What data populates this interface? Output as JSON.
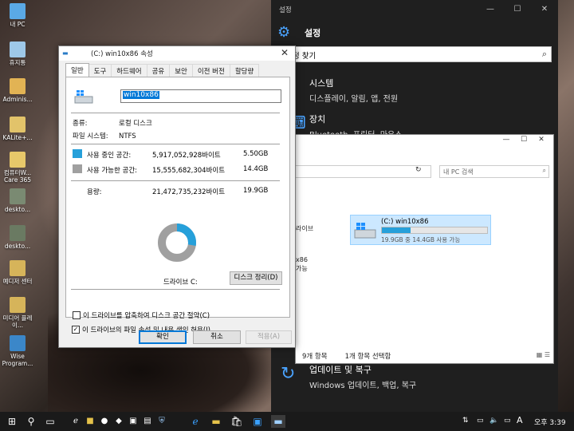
{
  "desktop": {
    "icons": [
      {
        "label": "내 PC",
        "color": "#5aa9e6"
      },
      {
        "label": "휴지통",
        "color": "#9ec8e8"
      },
      {
        "label": "Adminis...",
        "color": "#e2b354"
      },
      {
        "label": "KALite+...",
        "color": "#e2c36a"
      },
      {
        "label": "컴퓨터W... Care 365",
        "color": "#e7c86a"
      },
      {
        "label": "deskto...",
        "color": "#7a8a72"
      },
      {
        "label": "deskto...",
        "color": "#6a7a62"
      },
      {
        "label": "예디저 센터",
        "color": "#d6b45a"
      },
      {
        "label": "미디어 플레이...",
        "color": "#d6b45a"
      },
      {
        "label": "Wise Program...",
        "color": "#3b87c9"
      }
    ]
  },
  "settings": {
    "window_title": "설정",
    "minimize": "—",
    "maximize": "☐",
    "close": "✕",
    "heading": "설정",
    "search_text": "정 찾기",
    "categories": [
      {
        "title": "시스템",
        "subtitle": "디스플레이, 알림, 앱, 전원"
      },
      {
        "title": "장치",
        "subtitle": "Bluetooth, 프린터, 마우스"
      }
    ],
    "update": {
      "title": "업데이트 및 복구",
      "subtitle": "Windows 업데이트, 백업, 복구"
    }
  },
  "explorer": {
    "minimize": "—",
    "maximize": "☐",
    "close": "✕",
    "address_refresh": "↻",
    "search_placeholder": "내 PC 검색",
    "side_item1": "라이브",
    "side_item2": "x86",
    "side_item3": "가능",
    "drive": {
      "name": "(C:) win10x86",
      "used_fraction": 0.27,
      "free_text": "19.9GB 중 14.4GB 사용 가능"
    },
    "status": {
      "items": "9개 항목",
      "selected": "1개 항목 선택함"
    }
  },
  "dialog": {
    "title": "(C:) win10x86 속성",
    "close": "✕",
    "tabs": [
      "일반",
      "도구",
      "하드웨어",
      "공유",
      "보안",
      "이전 버전",
      "할당량"
    ],
    "active_tab": 0,
    "name_value": "win10x86",
    "type_label": "종류:",
    "type_value": "로컬 디스크",
    "fs_label": "파일 시스템:",
    "fs_value": "NTFS",
    "used": {
      "label": "사용 중인 공간:",
      "bytes": "5,917,052,928바이트",
      "gb": "5.50GB",
      "color": "#26a0da"
    },
    "free": {
      "label": "사용 가능한 공간:",
      "bytes": "15,555,682,304바이트",
      "gb": "14.4GB",
      "color": "#a0a0a0"
    },
    "capacity": {
      "label": "용량:",
      "bytes": "21,472,735,232바이트",
      "gb": "19.9GB"
    },
    "used_fraction": 0.276,
    "drive_label": "드라이브 C:",
    "cleanup_button": "디스크 정리(D)",
    "compress_label": "이 드라이브를 압축하여 디스크 공간 절약(C)",
    "compress_checked": false,
    "index_label": "이 드라이브의 파일 속성 및 내용 색인 허용(I)",
    "index_checked": true,
    "ok": "확인",
    "cancel": "취소",
    "apply": "적용(A)"
  },
  "taskbar": {
    "ime": "A",
    "clock": "오후 3:39"
  }
}
